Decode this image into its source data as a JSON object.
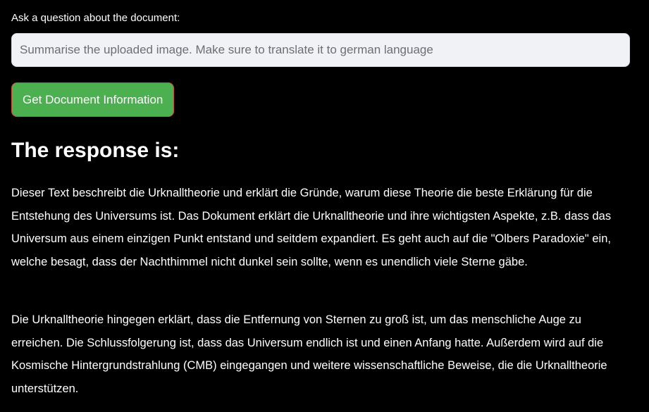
{
  "question": {
    "label": "Ask a question about the document:",
    "value": "",
    "placeholder": "Summarise the uploaded image. Make sure to translate it to german language"
  },
  "actions": {
    "get_info_label": "Get Document Information"
  },
  "response": {
    "heading": "The response is:",
    "paragraphs": [
      "Dieser Text beschreibt die Urknalltheorie und erklärt die Gründe, warum diese Theorie die beste Erklärung für die Entstehung des Universums ist. Das Dokument erklärt die Urknalltheorie und ihre wichtigsten Aspekte, z.B. dass das Universum aus einem einzigen Punkt entstand und seitdem expandiert. Es geht auch auf die \"Olbers Paradoxie\" ein, welche besagt, dass der Nachthimmel nicht dunkel sein sollte, wenn es unendlich viele Sterne gäbe.",
      "Die Urknalltheorie hingegen erklärt, dass die Entfernung von Sternen zu groß ist, um das menschliche Auge zu erreichen. Die Schlussfolgerung ist, dass das Universum endlich ist und einen Anfang hatte. Außerdem wird auf die Kosmische Hintergrundstrahlung (CMB) eingegangen und weitere wissenschaftliche Beweise, die die Urknalltheorie unterstützen."
    ]
  },
  "colors": {
    "background": "#000000",
    "text": "#ffffff",
    "input_background": "#f0f2f6",
    "button_background": "#4caf50",
    "button_border": "#c94a3b"
  }
}
